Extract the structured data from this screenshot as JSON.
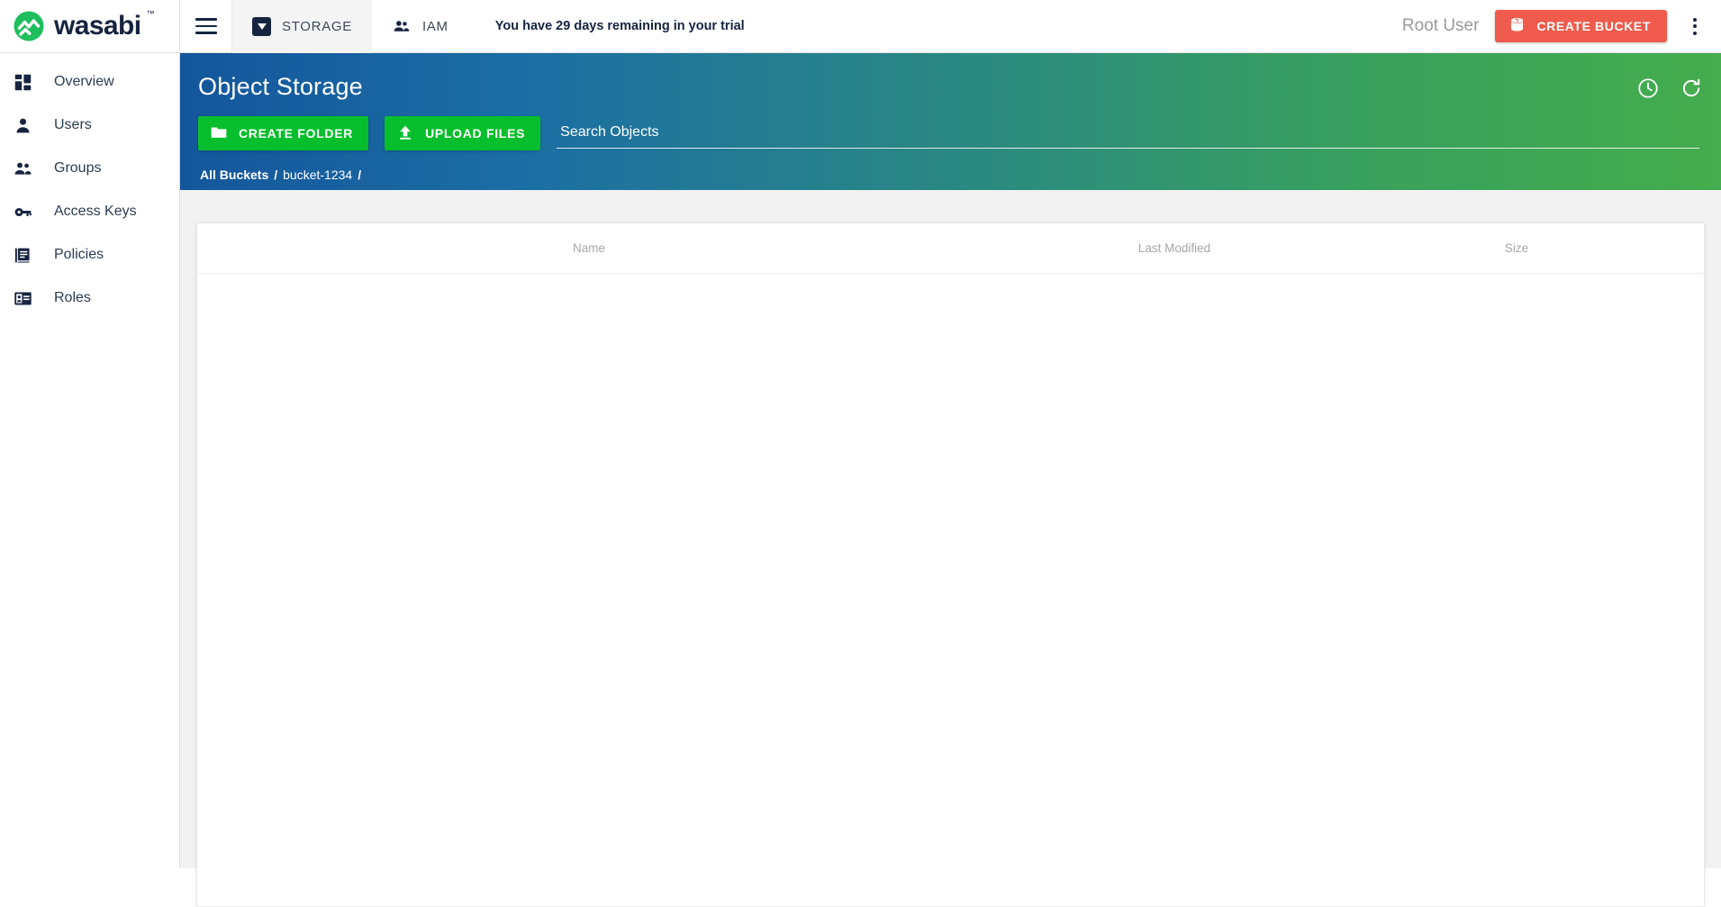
{
  "brand": {
    "name": "wasabi",
    "tm": "™",
    "logo_icon": "wasabi-logo-icon",
    "mark_color": "#1dbf5c",
    "word_color": "#16243f"
  },
  "topbar": {
    "menu_icon": "hamburger-menu-icon",
    "tabs": [
      {
        "label": "STORAGE",
        "icon": "storage-box-icon",
        "active": true
      },
      {
        "label": "IAM",
        "icon": "people-icon",
        "active": false
      }
    ],
    "trial_message": "You have 29 days remaining in your trial",
    "user_label": "Root User",
    "create_bucket_label": "CREATE BUCKET",
    "create_bucket_icon": "bucket-icon",
    "create_bucket_color": "#ef5b4c",
    "overflow_icon": "kebab-menu-icon"
  },
  "sidebar": {
    "items": [
      {
        "label": "Overview",
        "icon": "dashboard-icon"
      },
      {
        "label": "Users",
        "icon": "person-icon"
      },
      {
        "label": "Groups",
        "icon": "people-icon"
      },
      {
        "label": "Access Keys",
        "icon": "key-icon"
      },
      {
        "label": "Policies",
        "icon": "policy-document-icon"
      },
      {
        "label": "Roles",
        "icon": "id-badge-icon"
      }
    ]
  },
  "banner": {
    "title": "Object Storage",
    "gradient_from": "#14569c",
    "gradient_to": "#45ad4d",
    "button_color": "#07bf2c",
    "create_folder_label": "CREATE FOLDER",
    "create_folder_icon": "folder-icon",
    "upload_files_label": "UPLOAD FILES",
    "upload_files_icon": "upload-arrow-icon",
    "history_icon": "clock-history-icon",
    "refresh_icon": "refresh-icon"
  },
  "search": {
    "placeholder": "Search Objects",
    "value": ""
  },
  "breadcrumb": {
    "root": "All Buckets",
    "sep1": "/",
    "bucket": "bucket-1234",
    "sep2": "/"
  },
  "table": {
    "columns": [
      {
        "label": "Name"
      },
      {
        "label": "Last Modified"
      },
      {
        "label": "Size"
      }
    ],
    "rows": []
  }
}
